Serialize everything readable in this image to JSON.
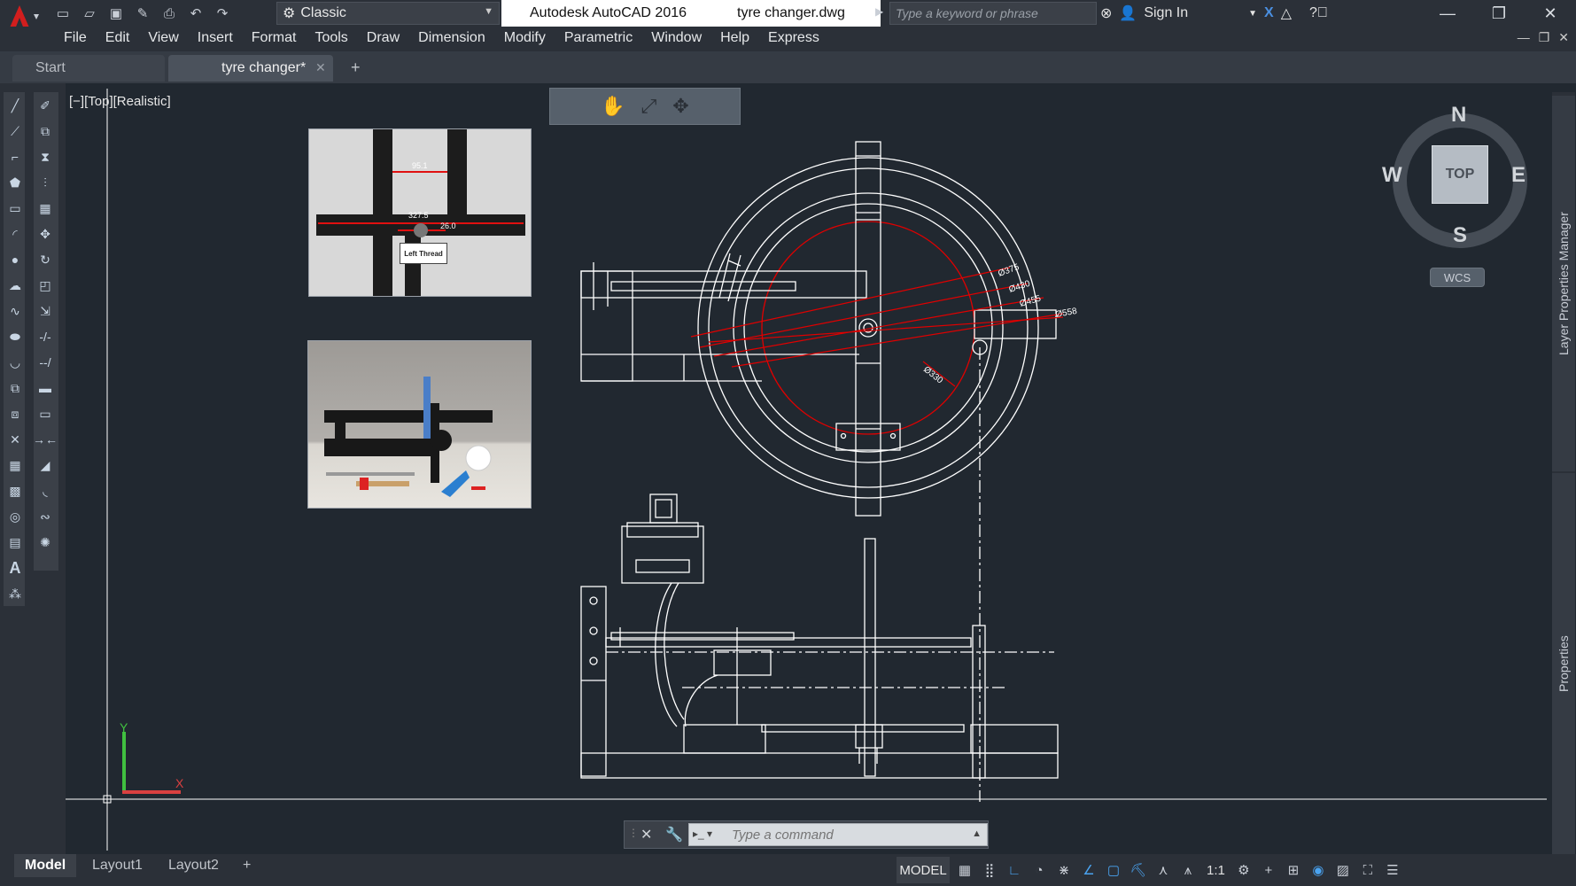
{
  "app": {
    "name": "Autodesk AutoCAD 2016",
    "document": "tyre changer.dwg",
    "workspace": "Classic",
    "search_placeholder": "Type a keyword or phrase",
    "sign_in": "Sign In"
  },
  "menus": [
    "File",
    "Edit",
    "View",
    "Insert",
    "Format",
    "Tools",
    "Draw",
    "Dimension",
    "Modify",
    "Parametric",
    "Window",
    "Help",
    "Express"
  ],
  "file_tabs": {
    "start": "Start",
    "active": "tyre changer*"
  },
  "viewport": {
    "label": "[−][Top][Realistic]"
  },
  "photo1": {
    "dim_top": "95.1",
    "dim_mid": "327.5",
    "dim_right": "26.0",
    "thread_label": "Left Thread"
  },
  "drawing_dims": {
    "d1": "Ø375",
    "d2": "Ø430",
    "d3": "Ø455",
    "d4": "Ø558",
    "d5": "Ø330"
  },
  "viewcube": {
    "north": "N",
    "south": "S",
    "east": "E",
    "west": "W",
    "face": "TOP",
    "ucs": "WCS"
  },
  "palettes": {
    "layer": "Layer Properties Manager",
    "properties": "Properties"
  },
  "command": {
    "placeholder": "Type a command"
  },
  "layout_tabs": [
    "Model",
    "Layout1",
    "Layout2"
  ],
  "status": {
    "model": "MODEL",
    "scale": "1:1"
  },
  "ucs_axes": {
    "x": "X",
    "y": "Y"
  },
  "colors": {
    "background": "#212830",
    "linework": "#ffffff",
    "dimension": "#e00000",
    "ucs_x": "#d94040",
    "ucs_y": "#40c040"
  }
}
